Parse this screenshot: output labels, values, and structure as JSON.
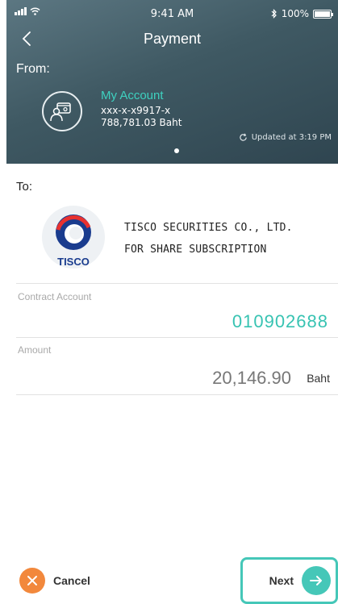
{
  "status_bar": {
    "time": "9:41 AM",
    "battery": "100%"
  },
  "nav": {
    "title": "Payment"
  },
  "from": {
    "label": "From:",
    "account_name": "My Account",
    "account_number": "xxx-x-x9917-x",
    "balance": "788,781.03 Baht",
    "updated": "Updated at 3:19 PM"
  },
  "to": {
    "label": "To:",
    "logo_text": "TISCO",
    "payee_line1": "TISCO SECURITIES CO., LTD.",
    "payee_line2": "FOR SHARE SUBSCRIPTION"
  },
  "fields": {
    "contract_label": "Contract Account",
    "contract_value": "010902688",
    "amount_label": "Amount",
    "amount_value": "20,146.90",
    "amount_unit": "Baht"
  },
  "footer": {
    "cancel_label": "Cancel",
    "next_label": "Next"
  },
  "colors": {
    "accent": "#45c7b8",
    "cancel": "#f2883c",
    "header": "#3f5963"
  }
}
